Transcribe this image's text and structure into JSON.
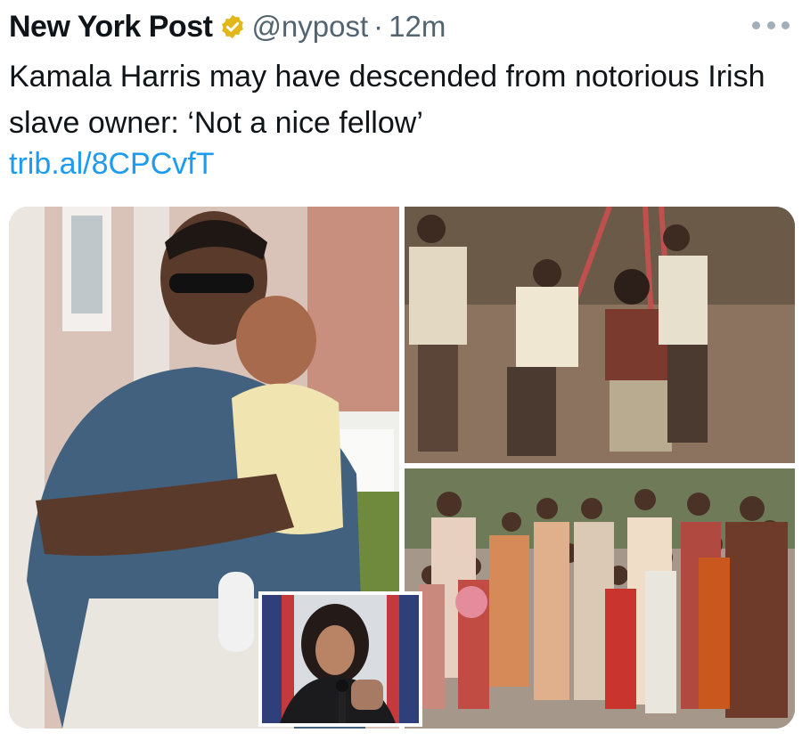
{
  "tweet": {
    "author_name": "New York Post",
    "handle": "@nypost",
    "separator": "·",
    "time": "12m",
    "text": "Kamala Harris may have descended from notorious Irish slave owner: ‘Not a nice fellow’",
    "link": "trib.al/8CPCvfT",
    "verified_badge_icon": "gold-verified-badge-icon",
    "more_icon": "more-options-icon"
  },
  "colors": {
    "text": "#0f1419",
    "secondary": "#536471",
    "link": "#1d9bf0",
    "badge": "#e2b719"
  },
  "media": {
    "photo_count": 4
  }
}
